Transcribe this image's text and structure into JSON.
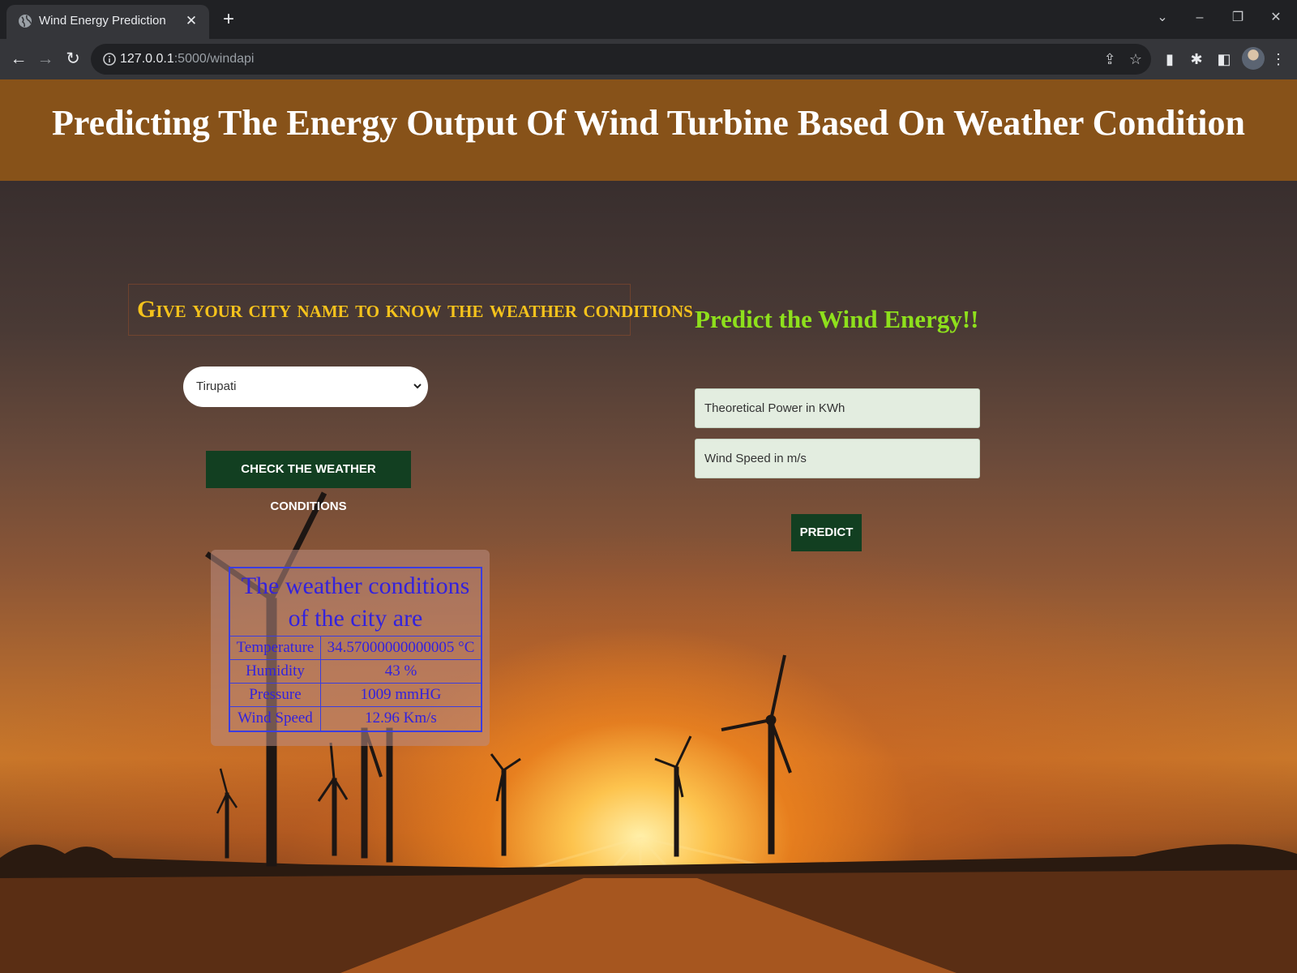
{
  "browser": {
    "tab_title": "Wind Energy Prediction",
    "url_host": "127.0.0.1",
    "url_path": ":5000/windapi"
  },
  "page": {
    "title": "Predicting The Energy Output Of Wind Turbine Based On Weather Condition",
    "weather_section": {
      "heading": "Give your city name to know the weather conditions",
      "city_select_value": "Tirupati",
      "check_button_label": "CHECK THE WEATHER CONDITIONS",
      "result_caption": "The weather conditions of the city are",
      "rows": [
        {
          "label": "Temperature",
          "value": "34.57000000000005 °C"
        },
        {
          "label": "Humidity",
          "value": "43 %"
        },
        {
          "label": "Pressure",
          "value": "1009 mmHG"
        },
        {
          "label": "Wind Speed",
          "value": "12.96 Km/s"
        }
      ]
    },
    "predict_section": {
      "heading": "Predict the Wind Energy!!",
      "power_placeholder": "Theoretical Power in KWh",
      "windspeed_placeholder": "Wind Speed in m/s",
      "predict_button_label": "PREDICT"
    }
  },
  "colors": {
    "banner": "#875219",
    "city_heading": "#f4c21c",
    "predict_heading": "#8ee01c",
    "button_bg": "#123f21",
    "table_text": "#3322dd"
  }
}
